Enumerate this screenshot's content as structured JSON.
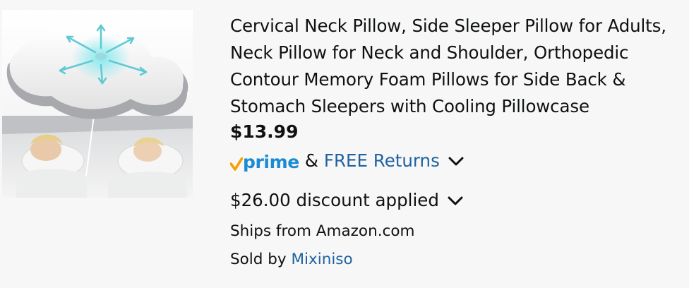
{
  "product": {
    "image_alt": "cervical-contour-pillow-photo",
    "title_lines": [
      "Cervical Neck Pillow, Side Sleeper Pillow for Adults,",
      "Neck Pillow for Neck and Shoulder, Orthopedic",
      "Contour Memory Foam Pillows for Side Back &",
      "Stomach Sleepers with Cooling Pillowcase"
    ],
    "price": "$13.99",
    "prime_label": "prime",
    "ampersand": "&",
    "free_returns": "FREE Returns",
    "discount": "$26.00 discount applied",
    "ships_from": "Ships from Amazon.com",
    "sold_by_prefix": "Sold by ",
    "seller": "Mixiniso"
  },
  "icons": {
    "prime_check": "prime-check-icon",
    "returns_chevron": "chevron-down-icon",
    "discount_chevron": "chevron-down-icon"
  },
  "colors": {
    "link": "#2162a1",
    "prime_blue": "#1a8bd4",
    "prime_check": "#f7a100",
    "text": "#0f1111",
    "background": "#f7f7f7"
  }
}
